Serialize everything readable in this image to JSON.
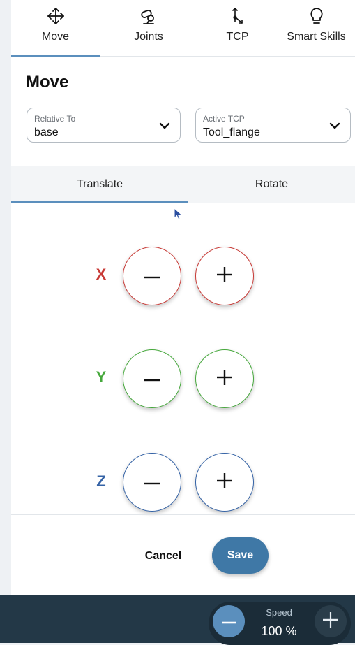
{
  "top_tabs": [
    {
      "label": "Move",
      "icon": "move-arrows-icon",
      "active": true
    },
    {
      "label": "Joints",
      "icon": "robot-joint-icon",
      "active": false
    },
    {
      "label": "TCP",
      "icon": "tcp-icon",
      "active": false
    },
    {
      "label": "Smart Skills",
      "icon": "lightbulb-icon",
      "active": false
    }
  ],
  "page_title": "Move",
  "relative_to": {
    "label": "Relative To",
    "value": "base"
  },
  "active_tcp": {
    "label": "Active TCP",
    "value": "Tool_flange"
  },
  "sub_tabs": [
    {
      "label": "Translate",
      "active": true
    },
    {
      "label": "Rotate",
      "active": false
    }
  ],
  "axes": [
    {
      "label": "X",
      "color": "#c83a36"
    },
    {
      "label": "Y",
      "color": "#46a83c"
    },
    {
      "label": "Z",
      "color": "#3563a6"
    }
  ],
  "actions": {
    "cancel": "Cancel",
    "save": "Save"
  },
  "speed": {
    "label": "Speed",
    "value": "100 %"
  },
  "colors": {
    "accent": "#5b8fbd",
    "save_button": "#3f78a6",
    "bottom_bar": "#233847"
  }
}
